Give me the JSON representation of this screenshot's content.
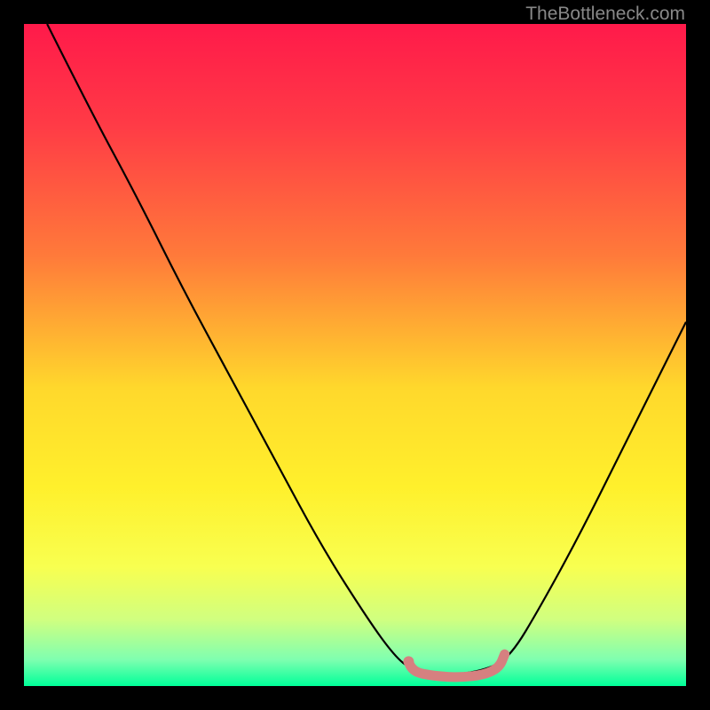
{
  "watermark": "TheBottleneck.com",
  "chart_data": {
    "type": "line",
    "title": "",
    "xlabel": "",
    "ylabel": "",
    "xlim": [
      0,
      746
    ],
    "ylim": [
      0,
      746
    ],
    "gradient_stops": [
      {
        "offset": 0,
        "color": "#ff1a4a"
      },
      {
        "offset": 0.15,
        "color": "#ff3a46"
      },
      {
        "offset": 0.35,
        "color": "#ff7a3a"
      },
      {
        "offset": 0.55,
        "color": "#ffd82c"
      },
      {
        "offset": 0.7,
        "color": "#fff02c"
      },
      {
        "offset": 0.82,
        "color": "#f8ff50"
      },
      {
        "offset": 0.9,
        "color": "#d0ff80"
      },
      {
        "offset": 0.96,
        "color": "#7fffb0"
      },
      {
        "offset": 1.0,
        "color": "#00ff99"
      }
    ],
    "curve": {
      "description": "V-shaped bottleneck curve, descending from upper-left, flat near x=0.58-0.71, rising to right edge",
      "points": [
        {
          "x": 0.035,
          "y": 0.0
        },
        {
          "x": 0.1,
          "y": 0.13
        },
        {
          "x": 0.17,
          "y": 0.26
        },
        {
          "x": 0.24,
          "y": 0.4
        },
        {
          "x": 0.31,
          "y": 0.53
        },
        {
          "x": 0.38,
          "y": 0.66
        },
        {
          "x": 0.45,
          "y": 0.79
        },
        {
          "x": 0.52,
          "y": 0.9
        },
        {
          "x": 0.56,
          "y": 0.955
        },
        {
          "x": 0.585,
          "y": 0.975
        },
        {
          "x": 0.64,
          "y": 0.985
        },
        {
          "x": 0.7,
          "y": 0.975
        },
        {
          "x": 0.735,
          "y": 0.955
        },
        {
          "x": 0.78,
          "y": 0.88
        },
        {
          "x": 0.84,
          "y": 0.77
        },
        {
          "x": 0.9,
          "y": 0.65
        },
        {
          "x": 0.96,
          "y": 0.53
        },
        {
          "x": 1.0,
          "y": 0.45
        }
      ]
    },
    "highlight_segment": {
      "color": "#d68080",
      "points": [
        {
          "x": 0.581,
          "y": 0.963
        },
        {
          "x": 0.585,
          "y": 0.978
        },
        {
          "x": 0.62,
          "y": 0.985
        },
        {
          "x": 0.66,
          "y": 0.987
        },
        {
          "x": 0.695,
          "y": 0.983
        },
        {
          "x": 0.718,
          "y": 0.972
        },
        {
          "x": 0.726,
          "y": 0.952
        }
      ],
      "start_dot": {
        "x": 0.581,
        "y": 0.963,
        "r": 6
      }
    }
  }
}
